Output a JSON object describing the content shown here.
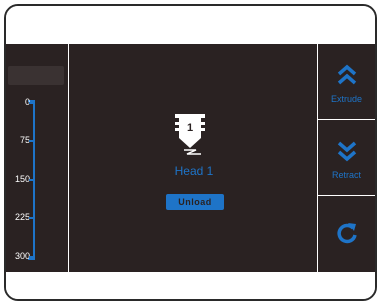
{
  "scale": {
    "ticks": [
      "0",
      "75",
      "150",
      "225",
      "300"
    ]
  },
  "head": {
    "number": "1",
    "label": "Head 1"
  },
  "buttons": {
    "unload": "Unload",
    "extrude": "Extrude",
    "retract": "Retract"
  },
  "icons": {
    "extrude": "double-chevron-up-icon",
    "retract": "double-chevron-down-icon",
    "refresh": "refresh-icon",
    "head": "print-head-icon"
  },
  "colors": {
    "accent": "#1e74c8",
    "screen_bg": "#2a2222",
    "text": "#ffffff"
  }
}
